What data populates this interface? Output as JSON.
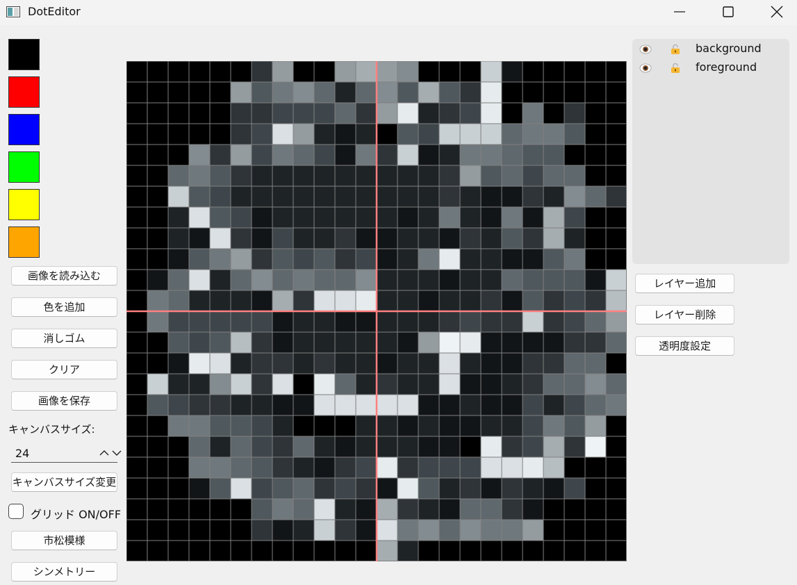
{
  "window": {
    "title": "DotEditor"
  },
  "palette": [
    "#000000",
    "#ff0000",
    "#0000ff",
    "#00ff00",
    "#ffff00",
    "#ffa500"
  ],
  "buttons": {
    "load_image": "画像を読み込む",
    "add_color": "色を追加",
    "eraser": "消しゴム",
    "clear": "クリア",
    "save_image": "画像を保存",
    "change_canvas_size": "キャンバスサイズ変更",
    "checker_pattern": "市松模様",
    "symmetry": "シンメトリー"
  },
  "canvas_size": {
    "label": "キャンバスサイズ:",
    "value": "24"
  },
  "grid_toggle": {
    "label": "グリッド ON/OFF",
    "checked": false
  },
  "layers": {
    "items": [
      {
        "name": "background",
        "visible": true,
        "locked": true
      },
      {
        "name": "foreground",
        "visible": true,
        "locked": true
      }
    ],
    "add_button": "レイヤー追加",
    "delete_button": "レイヤー削除",
    "opacity_button": "透明度設定"
  },
  "colors": {
    "symmetry_line": "#ff8080",
    "grid_line": "#808080"
  },
  "pixel_grid": {
    "size": 24,
    "symmetry_axis": {
      "column": 12,
      "row": 12
    },
    "rows": [
      "00000039009a98000c100000",
      "00000957862685a53e000000",
      "0000033444639e234e070300",
      "0000034d9212054ccc677500",
      "0008394764173c1277655000",
      "006753222222222395646600",
      "00c5422222222223211328630",
      "002d5412222221272171a400",
      "0021d314223112213253a200",
      "001579354534127e2211570000",
      "016d2686766822212265551c0",
      "0762221a3dde22122315343b0",
      "0744444122112223433c34696",
      "00545b312222219fe111133600",
      "001ed2332322122d211336600",
      "0c228c3d0e62322d11236686",
      "054332211ddddd11211424670",
      "00775542000221211224759000",
      "00062643621222110e34a3f000",
      "000776532134e3444ddeb000",
      "00015d4563431e5231321400",
      "000000576d21a321663100000",
      "000000312c31d7868779000000",
      "000000000000a20000000000"
    ]
  }
}
